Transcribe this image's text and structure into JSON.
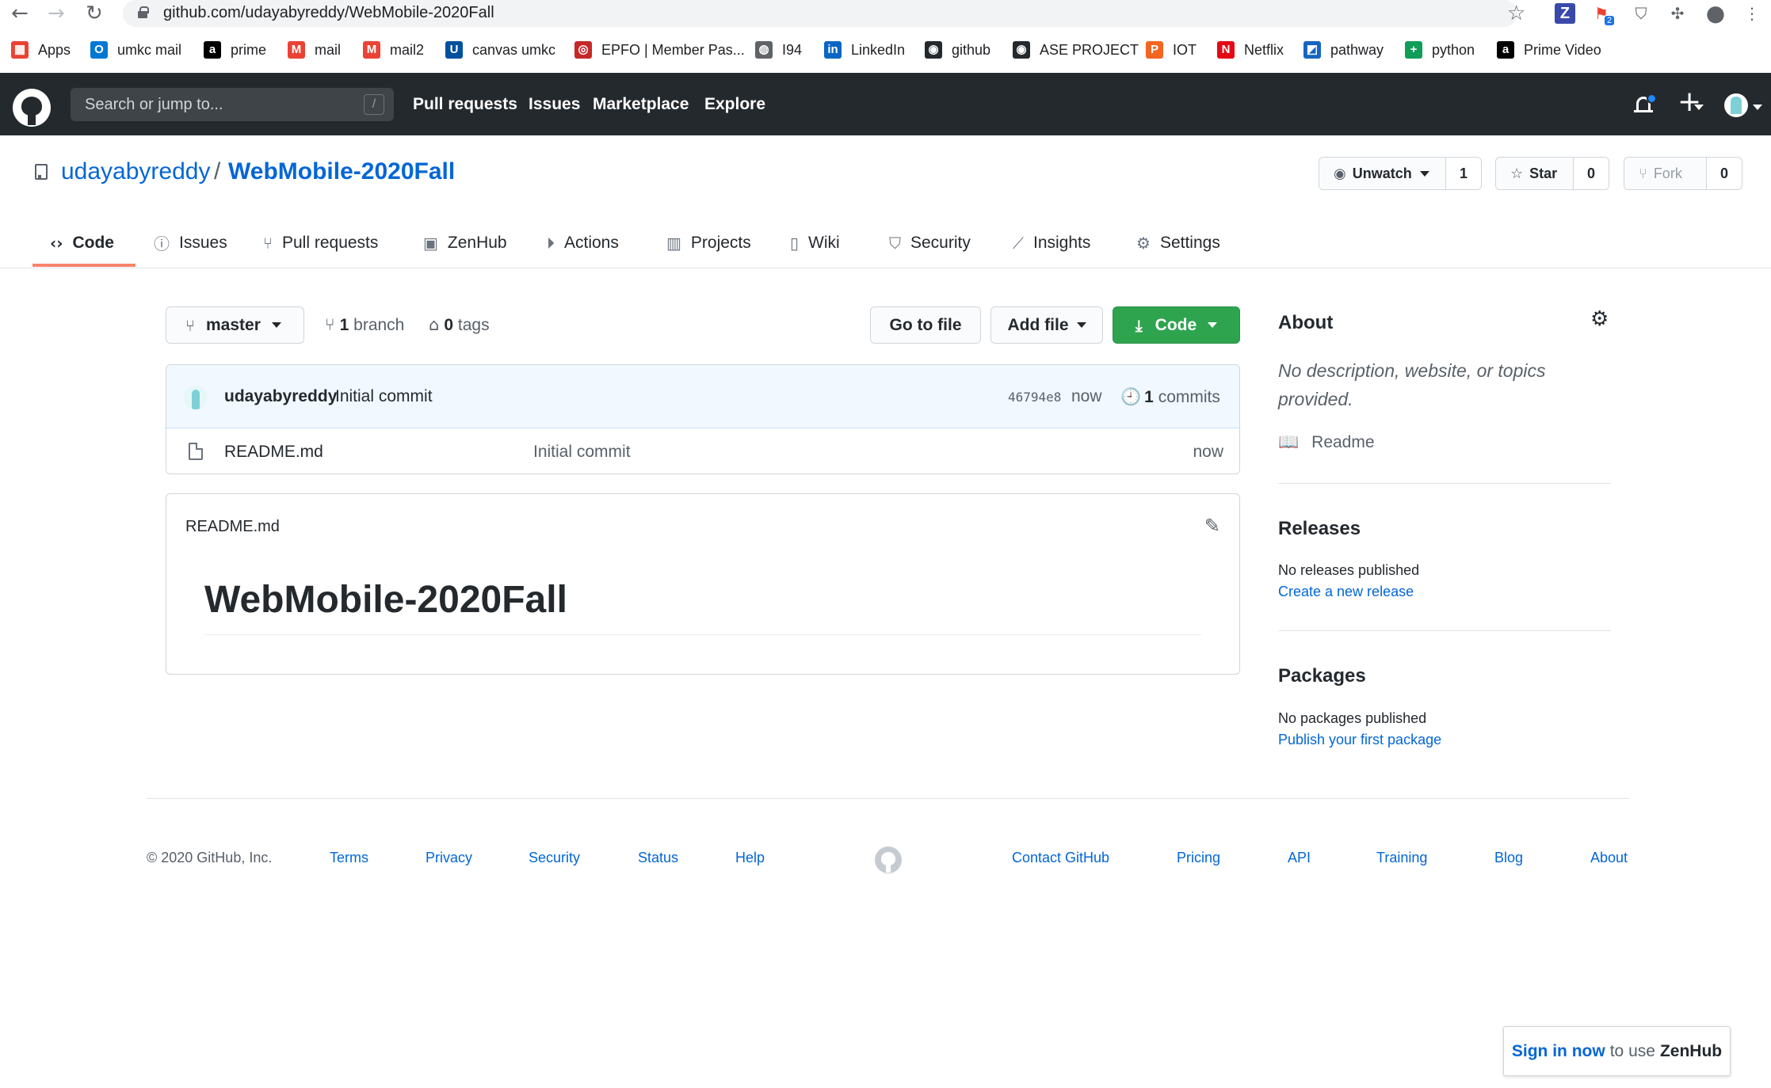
{
  "browser": {
    "url": "github.com/udayabyreddy/WebMobile-2020Fall",
    "bookmarks": [
      {
        "label": "Apps",
        "icon": "apps-grid-icon",
        "color": "#ea4335"
      },
      {
        "label": "umkc mail",
        "icon": "outlook-icon",
        "color": "#0078d4"
      },
      {
        "label": "prime",
        "icon": "amazon-icon",
        "color": "#000000"
      },
      {
        "label": "mail",
        "icon": "gmail-icon",
        "color": "#ea4335"
      },
      {
        "label": "mail2",
        "icon": "gmail-icon",
        "color": "#ea4335"
      },
      {
        "label": "canvas umkc",
        "icon": "umkc-icon",
        "color": "#0050a0"
      },
      {
        "label": "EPFO | Member Pas...",
        "icon": "epfo-icon",
        "color": "#c62828"
      },
      {
        "label": "I94",
        "icon": "globe-icon",
        "color": "#5f6368"
      },
      {
        "label": "LinkedIn",
        "icon": "linkedin-icon",
        "color": "#0a66c2"
      },
      {
        "label": "github",
        "icon": "github-icon",
        "color": "#24292e"
      },
      {
        "label": "ASE PROJECT",
        "icon": "github-icon",
        "color": "#24292e"
      },
      {
        "label": "IOT",
        "icon": "p-icon",
        "color": "#f26522"
      },
      {
        "label": "Netflix",
        "icon": "netflix-icon",
        "color": "#e50914"
      },
      {
        "label": "pathway",
        "icon": "pathway-icon",
        "color": "#1565c0"
      },
      {
        "label": "python",
        "icon": "plus-box-icon",
        "color": "#0f9d58"
      },
      {
        "label": "Prime Video",
        "icon": "amazon-icon",
        "color": "#000000"
      }
    ],
    "extension_badge": "2"
  },
  "header": {
    "search_placeholder": "Search or jump to...",
    "slash_key": "/",
    "nav": [
      "Pull requests",
      "Issues",
      "Marketplace",
      "Explore"
    ]
  },
  "repo": {
    "owner": "udayabyreddy",
    "separator": "/",
    "name": "WebMobile-2020Fall",
    "watch_label": "Unwatch",
    "watch_count": "1",
    "star_label": "Star",
    "star_count": "0",
    "fork_label": "Fork",
    "fork_count": "0"
  },
  "tabs": [
    {
      "label": "Code",
      "icon": "code-icon",
      "glyph": "‹›",
      "selected": true
    },
    {
      "label": "Issues",
      "icon": "issue-icon",
      "glyph": "ⓘ"
    },
    {
      "label": "Pull requests",
      "icon": "pull-request-icon",
      "glyph": "⑂"
    },
    {
      "label": "ZenHub",
      "icon": "zenhub-icon",
      "glyph": "▣"
    },
    {
      "label": "Actions",
      "icon": "play-icon",
      "glyph": "⏵"
    },
    {
      "label": "Projects",
      "icon": "project-icon",
      "glyph": "▥"
    },
    {
      "label": "Wiki",
      "icon": "book-icon",
      "glyph": "▯"
    },
    {
      "label": "Security",
      "icon": "shield-icon",
      "glyph": "⛉"
    },
    {
      "label": "Insights",
      "icon": "graph-icon",
      "glyph": "⟋"
    },
    {
      "label": "Settings",
      "icon": "gear-icon",
      "glyph": "⚙"
    }
  ],
  "filenav": {
    "branch": "master",
    "branch_count": "1",
    "branch_word": "branch",
    "tag_count": "0",
    "tag_word": "tags",
    "go_to_file": "Go to file",
    "add_file": "Add file",
    "code": "Code"
  },
  "commit": {
    "author": "udayabyreddy",
    "message": "Initial commit",
    "sha": "46794e8",
    "time": "now",
    "count": "1",
    "count_word": "commits"
  },
  "files": [
    {
      "name": "README.md",
      "commit": "Initial commit",
      "time": "now"
    }
  ],
  "readme": {
    "filename": "README.md",
    "heading": "WebMobile-2020Fall"
  },
  "sidebar": {
    "about_title": "About",
    "about_desc": "No description, website, or topics provided.",
    "readme_label": "Readme",
    "releases_title": "Releases",
    "releases_empty": "No releases published",
    "releases_link": "Create a new release",
    "packages_title": "Packages",
    "packages_empty": "No packages published",
    "packages_link": "Publish your first package"
  },
  "footer": {
    "copyright": "© 2020 GitHub, Inc.",
    "left_links": [
      "Terms",
      "Privacy",
      "Security",
      "Status",
      "Help"
    ],
    "right_links": [
      "Contact GitHub",
      "Pricing",
      "API",
      "Training",
      "Blog",
      "About"
    ]
  },
  "zenhub": {
    "sign_in": "Sign in now",
    "middle": "to use",
    "brand": "ZenHub"
  }
}
